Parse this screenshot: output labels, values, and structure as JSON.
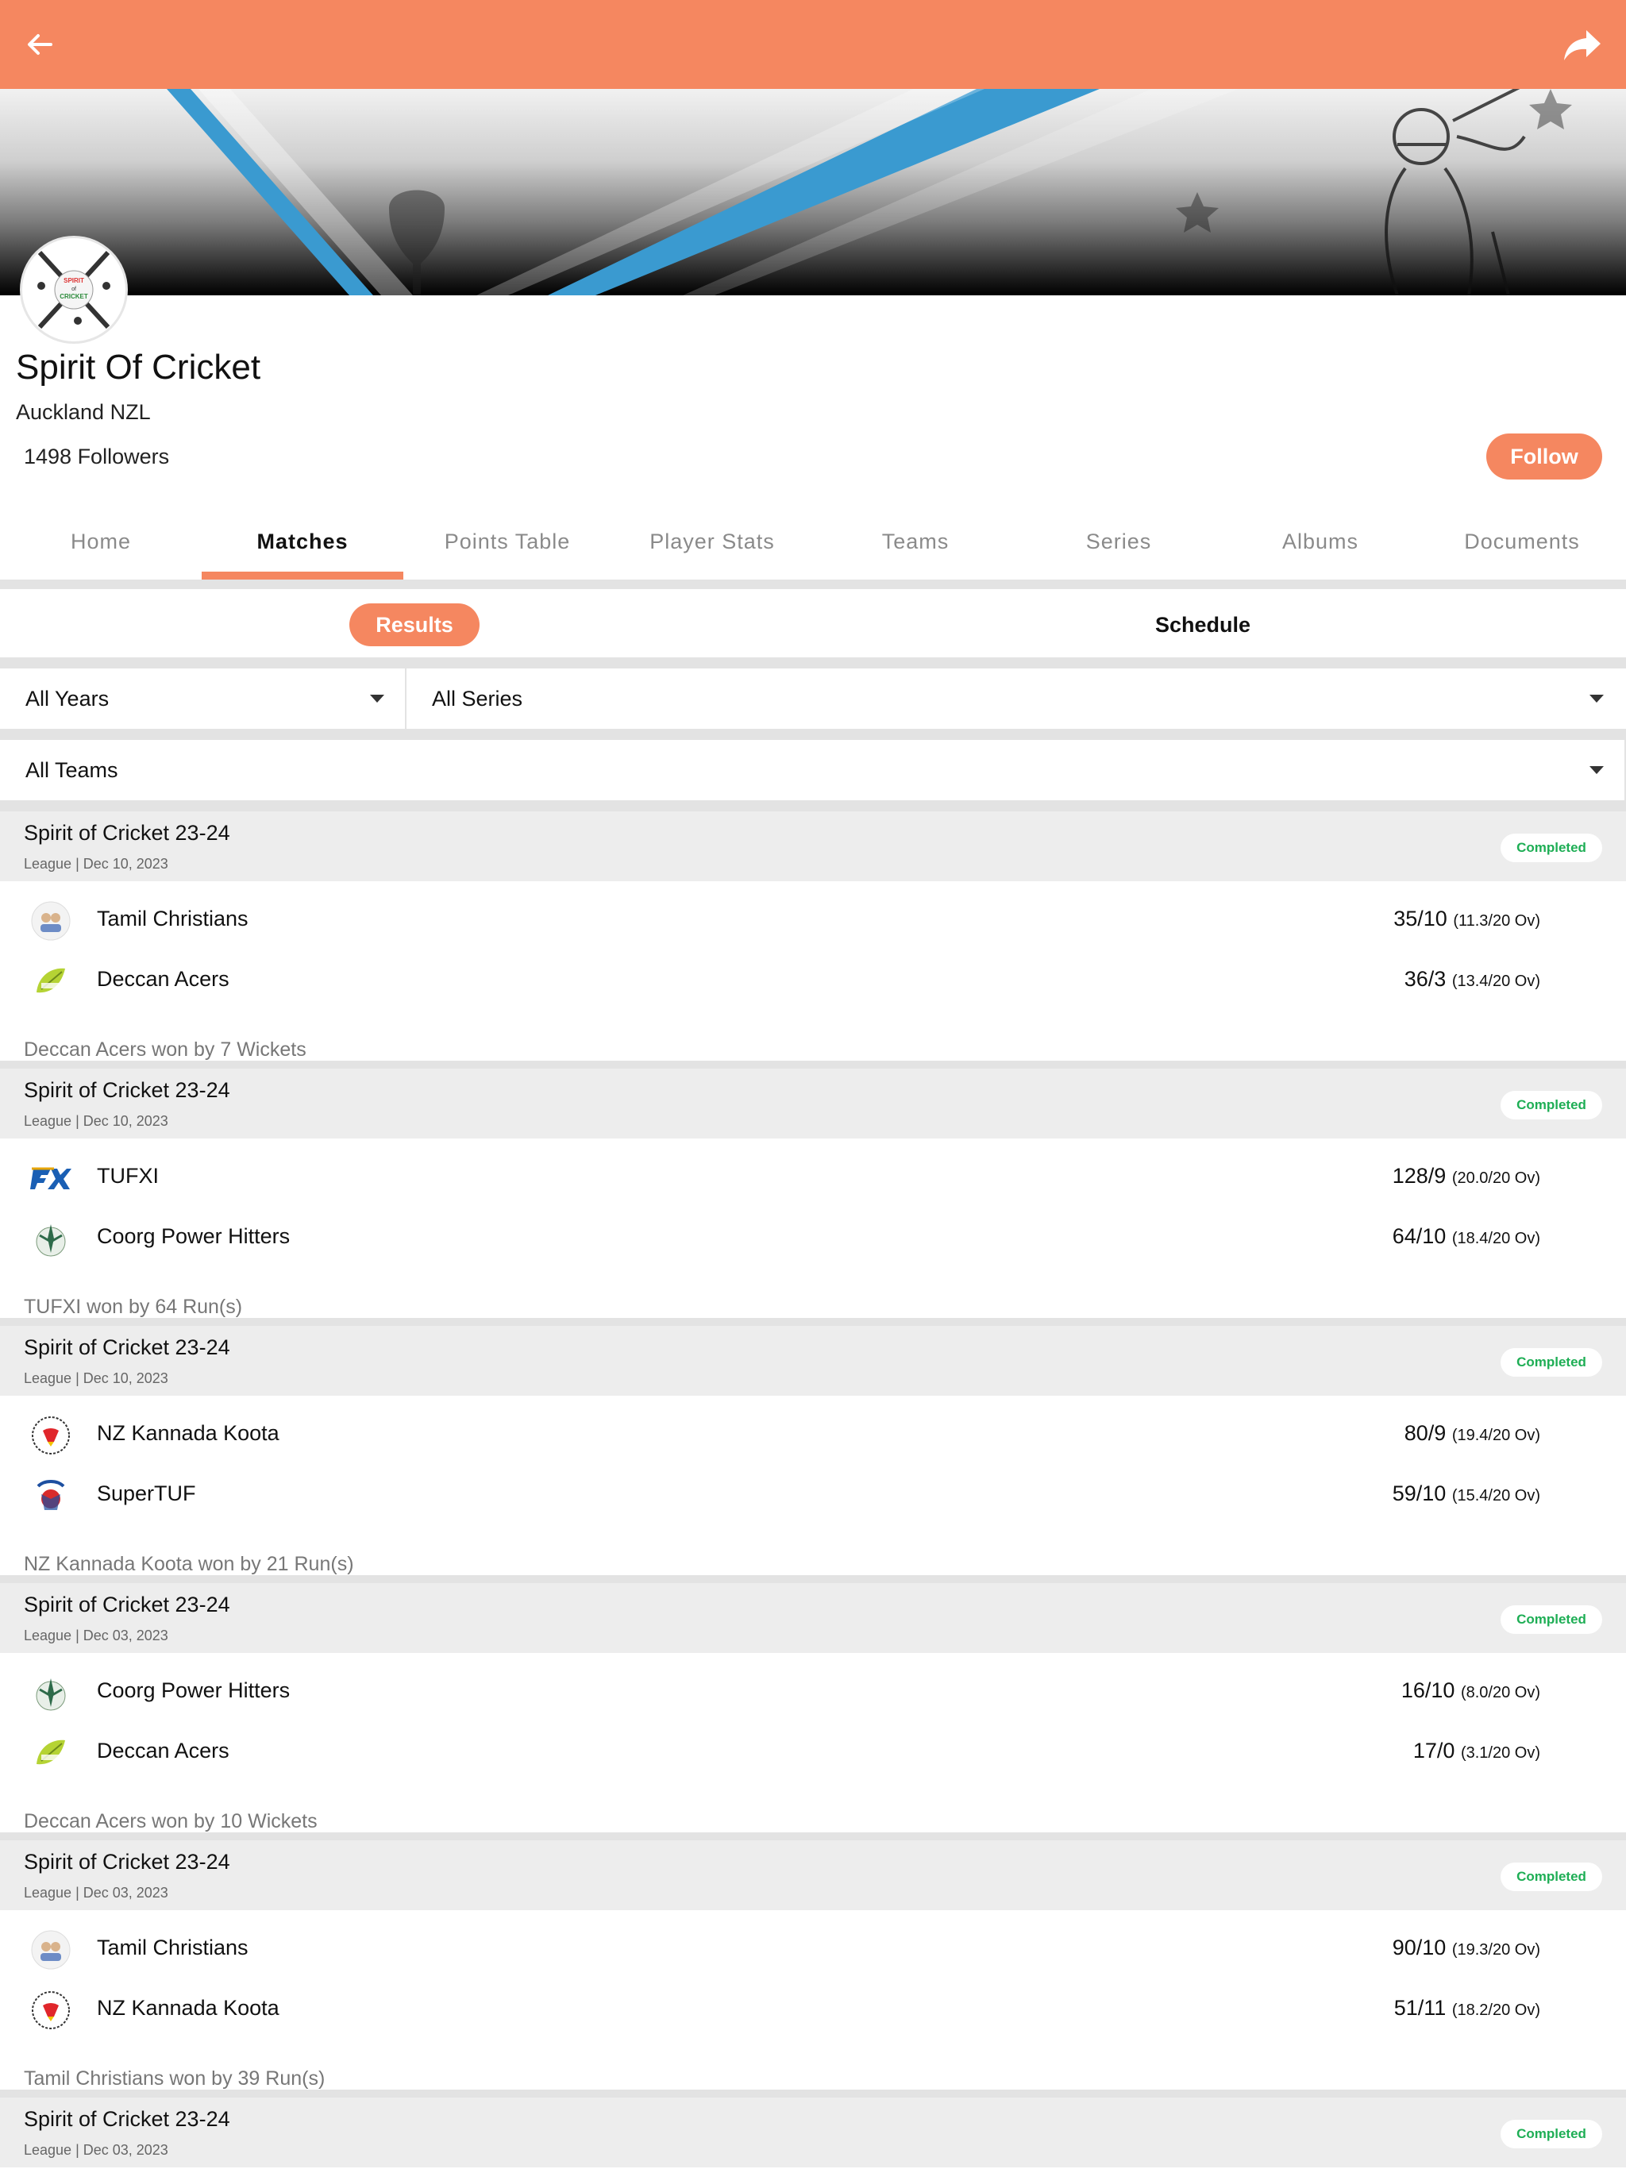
{
  "colors": {
    "accent": "#f58760",
    "completed": "#1eae55",
    "separator": "#e3e3e3"
  },
  "header": {
    "back_icon": "arrow-left-icon",
    "share_icon": "share-icon"
  },
  "club": {
    "logo_text_top": "SPIRIT",
    "logo_text_mid": "of",
    "logo_text_bottom": "CRICKET",
    "name": "Spirit Of Cricket",
    "location": "Auckland NZL",
    "followers": "1498 Followers",
    "follow_label": "Follow"
  },
  "tabs": [
    "Home",
    "Matches",
    "Points Table",
    "Player Stats",
    "Teams",
    "Series",
    "Albums",
    "Documents"
  ],
  "active_tab": "Matches",
  "subtabs": {
    "results": "Results",
    "schedule": "Schedule",
    "active": "Results"
  },
  "filters": {
    "years": "All Years",
    "series": "All Series",
    "teams": "All Teams"
  },
  "matches": [
    {
      "series": "Spirit of Cricket 23-24",
      "meta": "League | Dec 10, 2023",
      "status": "Completed",
      "team1": {
        "name": "Tamil Christians",
        "icon": "tamil-christians-logo-icon",
        "score": "35/10",
        "overs": "(11.3/20 Ov)"
      },
      "team2": {
        "name": "Deccan Acers",
        "icon": "deccan-acers-logo-icon",
        "score": "36/3",
        "overs": "(13.4/20 Ov)"
      },
      "result": "Deccan Acers won by 7 Wickets"
    },
    {
      "series": "Spirit of Cricket 23-24",
      "meta": "League | Dec 10, 2023",
      "status": "Completed",
      "team1": {
        "name": "TUFXI",
        "icon": "tufxi-logo-icon",
        "score": "128/9",
        "overs": "(20.0/20 Ov)"
      },
      "team2": {
        "name": "Coorg Power Hitters",
        "icon": "coorg-power-hitters-logo-icon",
        "score": "64/10",
        "overs": "(18.4/20 Ov)"
      },
      "result": "TUFXI won by 64 Run(s)"
    },
    {
      "series": "Spirit of Cricket 23-24",
      "meta": "League | Dec 10, 2023",
      "status": "Completed",
      "team1": {
        "name": "NZ Kannada Koota",
        "icon": "nz-kannada-koota-logo-icon",
        "score": "80/9",
        "overs": "(19.4/20 Ov)"
      },
      "team2": {
        "name": "SuperTUF",
        "icon": "supertuf-logo-icon",
        "score": "59/10",
        "overs": "(15.4/20 Ov)"
      },
      "result": "NZ Kannada Koota won by 21 Run(s)"
    },
    {
      "series": "Spirit of Cricket 23-24",
      "meta": "League | Dec 03, 2023",
      "status": "Completed",
      "team1": {
        "name": "Coorg Power Hitters",
        "icon": "coorg-power-hitters-logo-icon",
        "score": "16/10",
        "overs": "(8.0/20 Ov)"
      },
      "team2": {
        "name": "Deccan Acers",
        "icon": "deccan-acers-logo-icon",
        "score": "17/0",
        "overs": "(3.1/20 Ov)"
      },
      "result": "Deccan Acers won by 10 Wickets"
    },
    {
      "series": "Spirit of Cricket 23-24",
      "meta": "League | Dec 03, 2023",
      "status": "Completed",
      "team1": {
        "name": "Tamil Christians",
        "icon": "tamil-christians-logo-icon",
        "score": "90/10",
        "overs": "(19.3/20 Ov)"
      },
      "team2": {
        "name": "NZ Kannada Koota",
        "icon": "nz-kannada-koota-logo-icon",
        "score": "51/11",
        "overs": "(18.2/20 Ov)"
      },
      "result": "Tamil Christians won by 39 Run(s)"
    },
    {
      "series": "Spirit of Cricket 23-24",
      "meta": "League | Dec 03, 2023",
      "status": "Completed"
    }
  ]
}
